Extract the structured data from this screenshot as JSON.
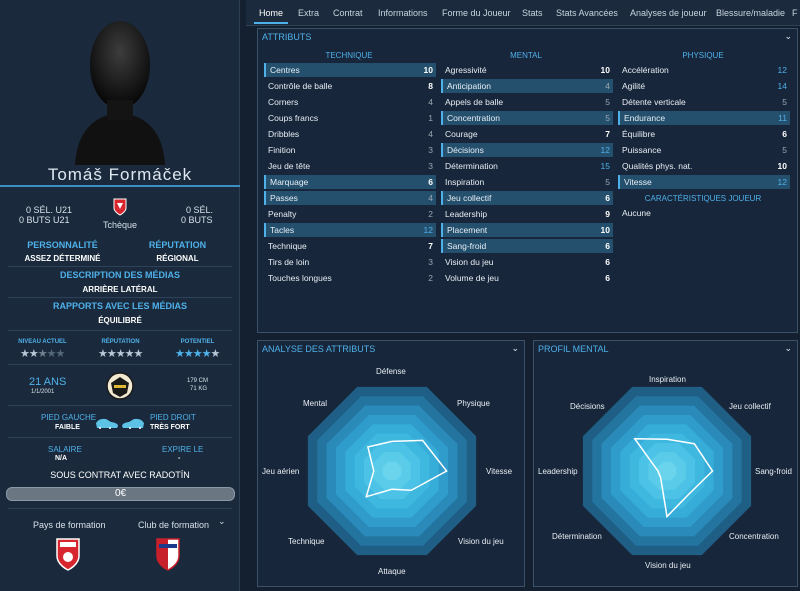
{
  "player": {
    "name": "Tomáš Formáček",
    "u21_caps": "0 SÉL. U21",
    "u21_goals": "0 BUTS U21",
    "caps": "0 SÉL.",
    "goals": "0 BUTS",
    "nationality": "Tchèque",
    "personality_label": "PERSONNALITÉ",
    "personality": "ASSEZ DÉTERMINÉ",
    "reputation_label": "RÉPUTATION",
    "reputation": "RÉGIONAL",
    "media_desc_label": "DESCRIPTION DES MÉDIAS",
    "media_desc": "ARRIÈRE LATÉRAL",
    "media_rel_label": "RAPPORTS AVEC LES MÉDIAS",
    "media_rel": "ÉQUILIBRÉ",
    "current_ability_label": "NIVEAU ACTUEL",
    "current_ability_stars": 2.5,
    "reputation_stars_label": "RÉPUTATION",
    "reputation_stars": 0,
    "potential_label": "POTENTIEL",
    "potential_stars": 4,
    "age": "21 ANS",
    "dob": "1/1/2001",
    "height": "179 CM",
    "weight": "71 KG",
    "left_foot_label": "PIED GAUCHE",
    "left_foot": "FAIBLE",
    "right_foot_label": "PIED DROIT",
    "right_foot": "TRÈS FORT",
    "salary_label": "SALAIRE",
    "salary": "N/A",
    "expires_label": "EXPIRE LE",
    "expires": "-",
    "contract": "SOUS CONTRAT AVEC RADOTÍN",
    "wage_value": "0€",
    "training_country_label": "Pays de formation",
    "training_club_label": "Club de formation",
    "colors": {
      "accent": "#4fb1ea",
      "background": "#14202f"
    }
  },
  "tabs": [
    "Home",
    "Extra",
    "Contrat",
    "Informations",
    "Forme du Joueur",
    "Stats",
    "Stats Avancées",
    "Analyses de joueur",
    "Blessure/maladie",
    "F"
  ],
  "attributes": {
    "title": "ATTRIBUTS",
    "technique_header": "TECHNIQUE",
    "mental_header": "MENTAL",
    "physique_header": "PHYSIQUE",
    "technique": [
      {
        "name": "Centres",
        "value": "10",
        "hl": true,
        "style": "bold"
      },
      {
        "name": "Contrôle de balle",
        "value": "8",
        "hl": false,
        "style": "bold"
      },
      {
        "name": "Corners",
        "value": "4",
        "hl": false,
        "style": "dim"
      },
      {
        "name": "Coups francs",
        "value": "1",
        "hl": false,
        "style": "dim"
      },
      {
        "name": "Dribbles",
        "value": "4",
        "hl": false,
        "style": "dim"
      },
      {
        "name": "Finition",
        "value": "3",
        "hl": false,
        "style": "dim"
      },
      {
        "name": "Jeu de tête",
        "value": "3",
        "hl": false,
        "style": "dim"
      },
      {
        "name": "Marquage",
        "value": "6",
        "hl": true,
        "style": "bold"
      },
      {
        "name": "Passes",
        "value": "4",
        "hl": true,
        "style": "dim"
      },
      {
        "name": "Penalty",
        "value": "2",
        "hl": false,
        "style": "dim"
      },
      {
        "name": "Tacles",
        "value": "12",
        "hl": true,
        "style": "blue"
      },
      {
        "name": "Technique",
        "value": "7",
        "hl": false,
        "style": "bold"
      },
      {
        "name": "Tirs de loin",
        "value": "3",
        "hl": false,
        "style": "dim"
      },
      {
        "name": "Touches longues",
        "value": "2",
        "hl": false,
        "style": "dim"
      }
    ],
    "mental": [
      {
        "name": "Agressivité",
        "value": "10",
        "hl": false,
        "style": "bold"
      },
      {
        "name": "Anticipation",
        "value": "4",
        "hl": true,
        "style": "dim"
      },
      {
        "name": "Appels de balle",
        "value": "5",
        "hl": false,
        "style": "dim"
      },
      {
        "name": "Concentration",
        "value": "5",
        "hl": true,
        "style": "dim"
      },
      {
        "name": "Courage",
        "value": "7",
        "hl": false,
        "style": "bold"
      },
      {
        "name": "Décisions",
        "value": "12",
        "hl": true,
        "style": "blue"
      },
      {
        "name": "Détermination",
        "value": "15",
        "hl": false,
        "style": "blue"
      },
      {
        "name": "Inspiration",
        "value": "5",
        "hl": false,
        "style": "dim"
      },
      {
        "name": "Jeu collectif",
        "value": "6",
        "hl": true,
        "style": "bold"
      },
      {
        "name": "Leadership",
        "value": "9",
        "hl": false,
        "style": "bold"
      },
      {
        "name": "Placement",
        "value": "10",
        "hl": true,
        "style": "bold"
      },
      {
        "name": "Sang-froid",
        "value": "6",
        "hl": true,
        "style": "bold"
      },
      {
        "name": "Vision du jeu",
        "value": "6",
        "hl": false,
        "style": "bold"
      },
      {
        "name": "Volume de jeu",
        "value": "6",
        "hl": false,
        "style": "bold"
      }
    ],
    "physique": [
      {
        "name": "Accélération",
        "value": "12",
        "hl": false,
        "style": "blue"
      },
      {
        "name": "Agilité",
        "value": "14",
        "hl": false,
        "style": "blue"
      },
      {
        "name": "Détente verticale",
        "value": "5",
        "hl": false,
        "style": "dim"
      },
      {
        "name": "Endurance",
        "value": "11",
        "hl": true,
        "style": "blue"
      },
      {
        "name": "Équilibre",
        "value": "6",
        "hl": false,
        "style": "bold"
      },
      {
        "name": "Puissance",
        "value": "5",
        "hl": false,
        "style": "dim"
      },
      {
        "name": "Qualités phys. nat.",
        "value": "10",
        "hl": false,
        "style": "bold"
      },
      {
        "name": "Vitesse",
        "value": "12",
        "hl": true,
        "style": "blue"
      }
    ],
    "traits_header": "CARACTÉRISTIQUES JOUEUR",
    "traits_value": "Aucune"
  },
  "attr_analysis": {
    "title": "ANALYSE DES ATTRIBUTS",
    "axes": [
      "Défense",
      "Physique",
      "Vitesse",
      "Vision du jeu",
      "Attaque",
      "Technique",
      "Jeu aérien",
      "Mental"
    ],
    "values": [
      6.5,
      9.5,
      12,
      6,
      4,
      8,
      4,
      7.5
    ]
  },
  "mental_profile": {
    "title": "PROFIL MENTAL",
    "axes": [
      "Inspiration",
      "Jeu collectif",
      "Sang-froid",
      "Concentration",
      "Vision du jeu",
      "Détermination",
      "Leadership",
      "Décisions"
    ],
    "values": [
      7,
      8.5,
      10,
      7,
      10,
      2,
      2,
      10
    ]
  }
}
